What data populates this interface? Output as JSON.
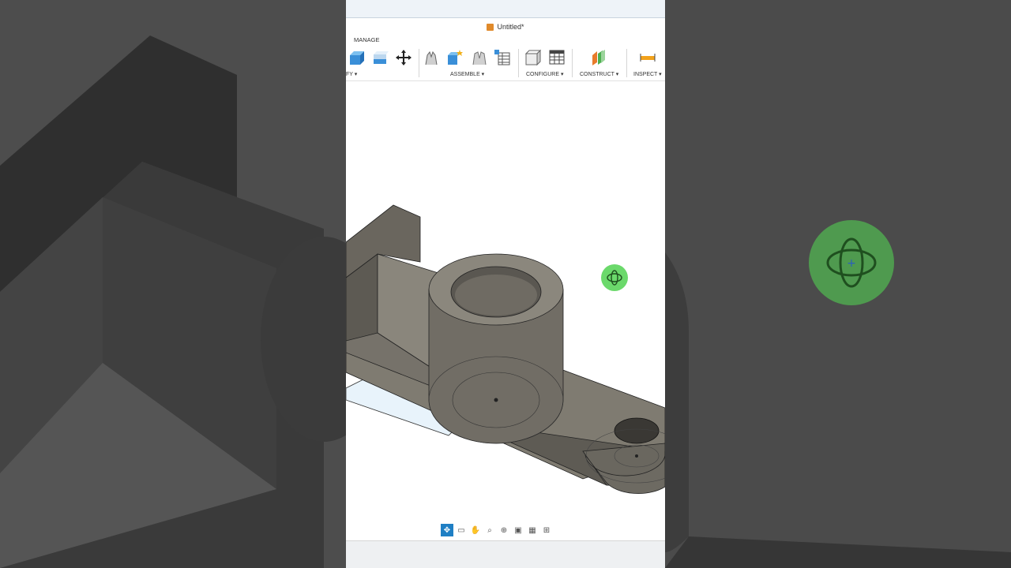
{
  "app": {
    "title": "Untitled*",
    "manage_tab": "MANAGE"
  },
  "toolbar": {
    "groups": [
      {
        "label": "FY ▾"
      },
      {
        "label": "ASSEMBLE ▾"
      },
      {
        "label": "CONFIGURE ▾"
      },
      {
        "label": "CONSTRUCT ▾"
      },
      {
        "label": "INSPECT ▾"
      }
    ]
  },
  "navbar": {
    "items": [
      "orbit",
      "look-at",
      "pan",
      "zoom",
      "fit",
      "display-settings",
      "grid-settings",
      "viewports"
    ]
  },
  "colors": {
    "model": "#7e7a70",
    "accent": "#1f7fc4",
    "orbit_cursor": "#6bd96b"
  }
}
